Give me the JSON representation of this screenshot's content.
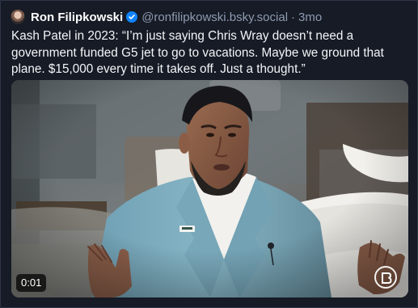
{
  "post": {
    "author": {
      "display_name": "Ron Filipkowski",
      "verified": true,
      "handle": "@ronfilipkowski.bsky.social",
      "separator": "·",
      "age": "3mo",
      "avatar_icon": "avatar-photo"
    },
    "text": "Kash Patel in 2023: “I’m just saying Chris Wray doesn’t need a government funded G5 jet to go to vacations. Maybe we ground that plane. $15,000 every time it takes off. Just a thought.”",
    "video": {
      "duration": "0:01",
      "watermark_icon": "circular-logo"
    }
  },
  "colors": {
    "background": "#161b25",
    "border": "#2e3646",
    "muted_text": "#8f9bb0",
    "verified_badge": "#1083fe",
    "video_timer_bg": "#000000"
  }
}
